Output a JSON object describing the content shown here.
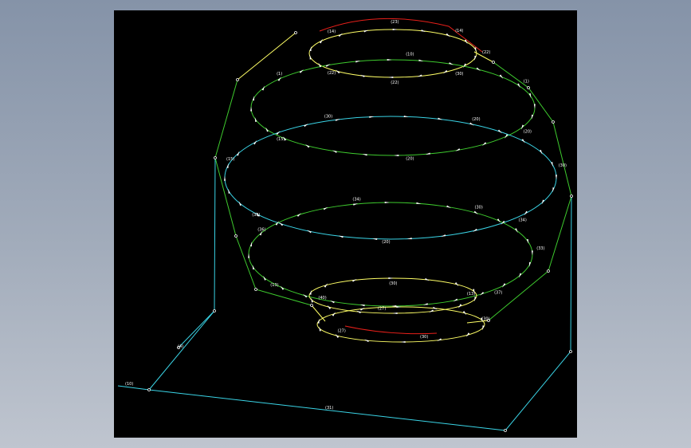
{
  "colors": {
    "background": "#000000",
    "rim": "#ffff66",
    "latitude_green": "#3ecb2e",
    "equator_cyan": "#3ad4e6",
    "highlight_red": "#e8201a",
    "labels": "#ffffff"
  },
  "labels": {
    "top_cap": [
      "(14)",
      "(23)",
      "(14)",
      "(22)",
      "(30)",
      "(22)",
      "(22)"
    ],
    "upper": [
      "(1)",
      "(10)",
      "(1)",
      "(20)",
      "(20)",
      "(15)"
    ],
    "equator": [
      "(15)",
      "(30)",
      "(20)",
      "(30)",
      "(34)",
      "(20)",
      "(38)"
    ],
    "lower": [
      "(36)",
      "(34)",
      "(30)",
      "(33)",
      "(37)",
      "(27)",
      "(13)"
    ],
    "bottom_cap": [
      "(40)",
      "(30)",
      "(13)",
      "(30)",
      "(30)",
      "(27)"
    ],
    "base": [
      "(10)",
      "(31)",
      "(4)"
    ]
  }
}
